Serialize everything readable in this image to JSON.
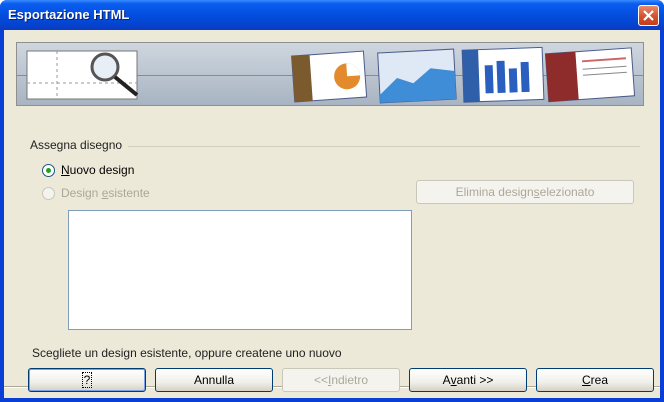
{
  "window": {
    "title": "Esportazione HTML"
  },
  "group": {
    "label": "Assegna disegno"
  },
  "options": {
    "new_design": {
      "pre": "",
      "u": "N",
      "post": "uovo design",
      "selected": true
    },
    "existing_design": {
      "pre": "Design ",
      "u": "e",
      "post": "sistente",
      "selected": false
    }
  },
  "delete_button": {
    "pre": "Elimina design ",
    "u": "s",
    "post": "elezionato"
  },
  "hint": "Scegliete un design esistente, oppure createne uno nuovo",
  "footer": {
    "help": "?",
    "cancel": "Annulla",
    "back": {
      "pre": "<< ",
      "u": "I",
      "post": "ndietro"
    },
    "next": {
      "pre": "A",
      "u": "v",
      "post": "anti >>"
    },
    "create": {
      "pre": "",
      "u": "C",
      "post": "rea"
    }
  },
  "colors": {
    "title_bar": "#0450e0",
    "dialog_bg": "#ece9d8",
    "radio_dot": "#21a121"
  }
}
